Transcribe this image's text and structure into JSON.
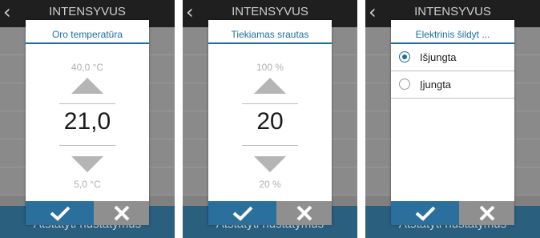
{
  "background": {
    "title": "INTENSYVUS",
    "footer": "Atstatyti nustatymus",
    "back_icon": "chevron-left-icon"
  },
  "dialogs": [
    {
      "title": "Oro temperatūra",
      "max": "40,0 °C",
      "value": "21,0",
      "min": "5,0 °C"
    },
    {
      "title": "Tiekiamas srautas",
      "max": "100 %",
      "value": "20",
      "min": "20 %"
    },
    {
      "title": "Elektrinis šildyt ...",
      "options": [
        {
          "label": "Išjungta",
          "selected": true
        },
        {
          "label": "Įjungta",
          "selected": false
        }
      ]
    }
  ],
  "buttons": {
    "confirm_icon": "checkmark-icon",
    "cancel_icon": "close-icon"
  },
  "colors": {
    "accent": "#2b6f9c",
    "title_text": "#1e6e9a",
    "cancel_bg": "#8f8f8f",
    "overlay": "#808080",
    "header": "#1f1f1f"
  }
}
